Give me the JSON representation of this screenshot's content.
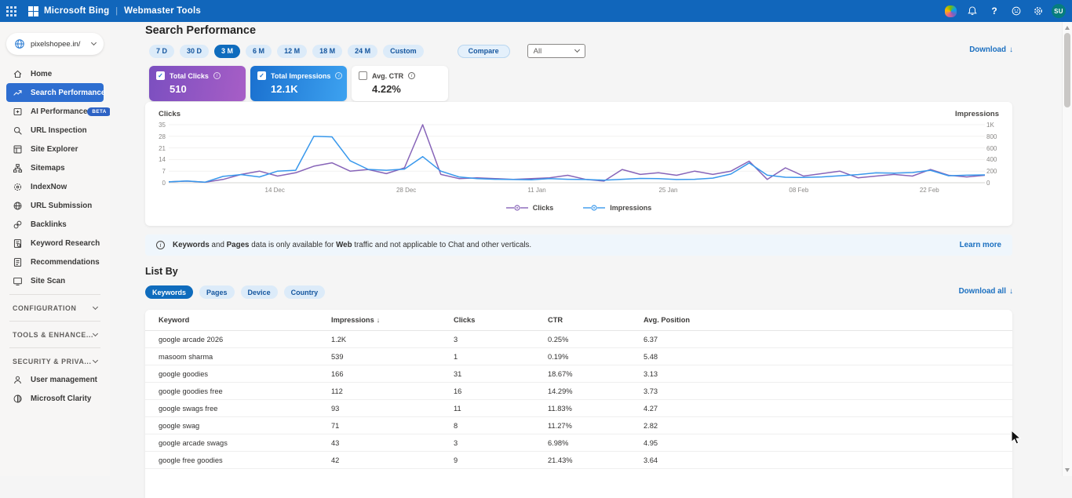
{
  "topbar": {
    "brand": "Microsoft Bing",
    "product": "Webmaster Tools",
    "avatar_initials": "SU",
    "icons": [
      "copilot-icon",
      "bell-icon",
      "help-icon",
      "feedback-icon",
      "settings-icon"
    ]
  },
  "sidebar": {
    "site": "pixelshopee.in/",
    "items": [
      {
        "label": "Home",
        "icon": "home",
        "selected": false
      },
      {
        "label": "Search Performance",
        "icon": "trend",
        "selected": true
      },
      {
        "label": "AI Performance",
        "icon": "ai",
        "selected": false,
        "badge": "BETA"
      },
      {
        "label": "URL Inspection",
        "icon": "search",
        "selected": false
      },
      {
        "label": "Site Explorer",
        "icon": "explorer",
        "selected": false
      },
      {
        "label": "Sitemaps",
        "icon": "sitemap",
        "selected": false
      },
      {
        "label": "IndexNow",
        "icon": "indexnow",
        "selected": false
      },
      {
        "label": "URL Submission",
        "icon": "globe",
        "selected": false
      },
      {
        "label": "Backlinks",
        "icon": "link",
        "selected": false
      },
      {
        "label": "Keyword Research",
        "icon": "keyword",
        "selected": false
      },
      {
        "label": "Recommendations",
        "icon": "recommend",
        "selected": false
      },
      {
        "label": "Site Scan",
        "icon": "scan",
        "selected": false
      }
    ],
    "sections": [
      "CONFIGURATION",
      "TOOLS & ENHANCE...",
      "SECURITY & PRIVA..."
    ],
    "footer_items": [
      {
        "label": "User management",
        "icon": "user"
      },
      {
        "label": "Microsoft Clarity",
        "icon": "clarity"
      }
    ]
  },
  "page": {
    "title": "Search Performance",
    "download_label": "Download",
    "download_icon": "↓"
  },
  "filters": {
    "time_ranges": [
      "7 D",
      "30 D",
      "3 M",
      "6 M",
      "12 M",
      "18 M",
      "24 M",
      "Custom"
    ],
    "selected_range": "3 M",
    "compare_label": "Compare",
    "dropdown_value": "All"
  },
  "metrics": [
    {
      "label": "Total Clicks",
      "value": "510",
      "checked": true,
      "theme": "purple"
    },
    {
      "label": "Total Impressions",
      "value": "12.1K",
      "checked": true,
      "theme": "blue"
    },
    {
      "label": "Avg. CTR",
      "value": "4.22%",
      "checked": false,
      "theme": "white"
    }
  ],
  "chart_data": {
    "type": "line",
    "left_axis": {
      "title": "Clicks",
      "ticks": [
        "0",
        "7",
        "14",
        "21",
        "28",
        "35"
      ],
      "tick_values": [
        0,
        7,
        14,
        21,
        28,
        35
      ],
      "max": 35
    },
    "right_axis": {
      "title": "Impressions",
      "ticks": [
        "0",
        "200",
        "400",
        "600",
        "800",
        "1K"
      ],
      "tick_values": [
        0,
        200,
        400,
        600,
        800,
        1000
      ],
      "max": 1000
    },
    "x_ticks": [
      "14 Dec",
      "28 Dec",
      "11 Jan",
      "25 Jan",
      "08 Feb",
      "22 Feb"
    ],
    "x_tick_fractions": [
      0.13,
      0.291,
      0.451,
      0.612,
      0.772,
      0.932
    ],
    "grid": true,
    "legend_position": "bottom-center",
    "series": [
      {
        "name": "Clicks",
        "axis": "left",
        "color": "#8764b8",
        "values": [
          0.5,
          1,
          0.3,
          2,
          5,
          7,
          4,
          6,
          10,
          12,
          7,
          8,
          5.5,
          9,
          35,
          5,
          2.5,
          3,
          2.5,
          2,
          2.5,
          3,
          4.5,
          2,
          1,
          8,
          5,
          6,
          4.5,
          7,
          5,
          7,
          13,
          2,
          9,
          4,
          5.5,
          7,
          3,
          4,
          5,
          4,
          8,
          4.5,
          3.5,
          4.5
        ]
      },
      {
        "name": "Impressions",
        "axis": "right",
        "color": "#3898ec",
        "values": [
          15,
          30,
          10,
          110,
          140,
          100,
          200,
          215,
          800,
          790,
          380,
          230,
          215,
          235,
          450,
          200,
          100,
          70,
          60,
          55,
          50,
          70,
          60,
          55,
          45,
          60,
          75,
          70,
          55,
          60,
          80,
          150,
          340,
          130,
          95,
          90,
          100,
          120,
          140,
          170,
          165,
          175,
          215,
          120,
          130,
          135
        ]
      }
    ]
  },
  "banner": {
    "segments": [
      {
        "text": "Keywords",
        "bold": true
      },
      {
        "text": " and ",
        "bold": false
      },
      {
        "text": "Pages",
        "bold": true
      },
      {
        "text": " data is only available for ",
        "bold": false
      },
      {
        "text": "Web",
        "bold": true
      },
      {
        "text": " traffic and not applicable to Chat and other verticals.",
        "bold": false
      }
    ],
    "learn_more": "Learn more"
  },
  "list_by": {
    "title": "List By",
    "tabs": [
      "Keywords",
      "Pages",
      "Device",
      "Country"
    ],
    "selected_tab": "Keywords",
    "download_all": "Download all",
    "download_icon": "↓"
  },
  "table": {
    "columns": [
      {
        "label": "Keyword",
        "sorted": false
      },
      {
        "label": "Impressions",
        "sorted": true
      },
      {
        "label": "Clicks",
        "sorted": false
      },
      {
        "label": "CTR",
        "sorted": false
      },
      {
        "label": "Avg. Position",
        "sorted": false
      }
    ],
    "sort_icon": "↓",
    "rows": [
      {
        "keyword": "google arcade 2026",
        "impressions": "1.2K",
        "clicks": "3",
        "ctr": "0.25%",
        "avg_position": "6.37"
      },
      {
        "keyword": "masoom sharma",
        "impressions": "539",
        "clicks": "1",
        "ctr": "0.19%",
        "avg_position": "5.48"
      },
      {
        "keyword": "google goodies",
        "impressions": "166",
        "clicks": "31",
        "ctr": "18.67%",
        "avg_position": "3.13"
      },
      {
        "keyword": "google goodies free",
        "impressions": "112",
        "clicks": "16",
        "ctr": "14.29%",
        "avg_position": "3.73"
      },
      {
        "keyword": "google swags free",
        "impressions": "93",
        "clicks": "11",
        "ctr": "11.83%",
        "avg_position": "4.27"
      },
      {
        "keyword": "google swag",
        "impressions": "71",
        "clicks": "8",
        "ctr": "11.27%",
        "avg_position": "2.82"
      },
      {
        "keyword": "google arcade swags",
        "impressions": "43",
        "clicks": "3",
        "ctr": "6.98%",
        "avg_position": "4.95"
      },
      {
        "keyword": "google free goodies",
        "impressions": "42",
        "clicks": "9",
        "ctr": "21.43%",
        "avg_position": "3.64"
      }
    ]
  },
  "colors": {
    "topbar": "#1166bb",
    "accent": "#0f6cbd",
    "sidebar_selected": "#2e6ed0",
    "clicks_line": "#8764b8",
    "impressions_line": "#3898ec",
    "banner_bg": "#eff6fc",
    "avatar_bg": "#067d7e"
  }
}
